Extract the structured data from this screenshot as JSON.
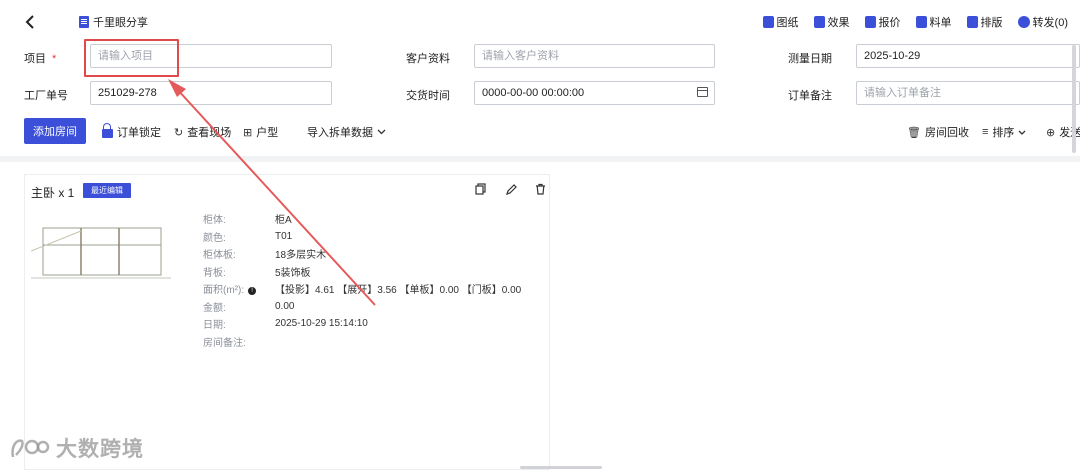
{
  "header": {
    "title": "千里眼分享",
    "actions": [
      {
        "label": "图纸",
        "icon": "drawing-icon"
      },
      {
        "label": "效果",
        "icon": "effect-icon"
      },
      {
        "label": "报价",
        "icon": "quote-icon"
      },
      {
        "label": "料单",
        "icon": "material-list-icon"
      },
      {
        "label": "排版",
        "icon": "layout-icon"
      },
      {
        "label": "转发(0)",
        "icon": "forward-icon"
      }
    ]
  },
  "form": {
    "project": {
      "label": "项目",
      "required_mark": "*",
      "placeholder": "请输入项目",
      "value": ""
    },
    "customer": {
      "label": "客户资料",
      "placeholder": "请输入客户资料",
      "value": ""
    },
    "measure_date": {
      "label": "测量日期",
      "value": "2025-10-29"
    },
    "factory_no": {
      "label": "工厂单号",
      "value": "251029-278"
    },
    "delivery_time": {
      "label": "交货时间",
      "value": "0000-00-00 00:00:00"
    },
    "order_note": {
      "label": "订单备注",
      "placeholder": "请输入订单备注",
      "value": ""
    }
  },
  "toolbar": {
    "add_room": "添加房间",
    "order_lock": "订单锁定",
    "view_site": "查看现场",
    "floor_plan": "户型",
    "import_data": "导入拆单数据",
    "room_recycle": "房间回收",
    "sort": "排序",
    "send": "发送"
  },
  "room_card": {
    "title": "主卧 x 1",
    "badge": "最近编辑",
    "properties": [
      {
        "key": "柜体:",
        "value": "柜A"
      },
      {
        "key": "颜色:",
        "value": "T01"
      },
      {
        "key": "柜体板:",
        "value": "18多层实木"
      },
      {
        "key": "背板:",
        "value": "5装饰板"
      },
      {
        "key": "面积(m²):",
        "value": "【投影】4.61 【展开】3.56 【单板】0.00 【门板】0.00"
      },
      {
        "key": "金额:",
        "value": "0.00"
      },
      {
        "key": "日期:",
        "value": "2025-10-29 15:14:10"
      },
      {
        "key": "房间备注:",
        "value": ""
      }
    ]
  },
  "watermark": "大数跨境",
  "colors": {
    "primary": "#3b4fd8",
    "annotation": "#e04a4a"
  }
}
